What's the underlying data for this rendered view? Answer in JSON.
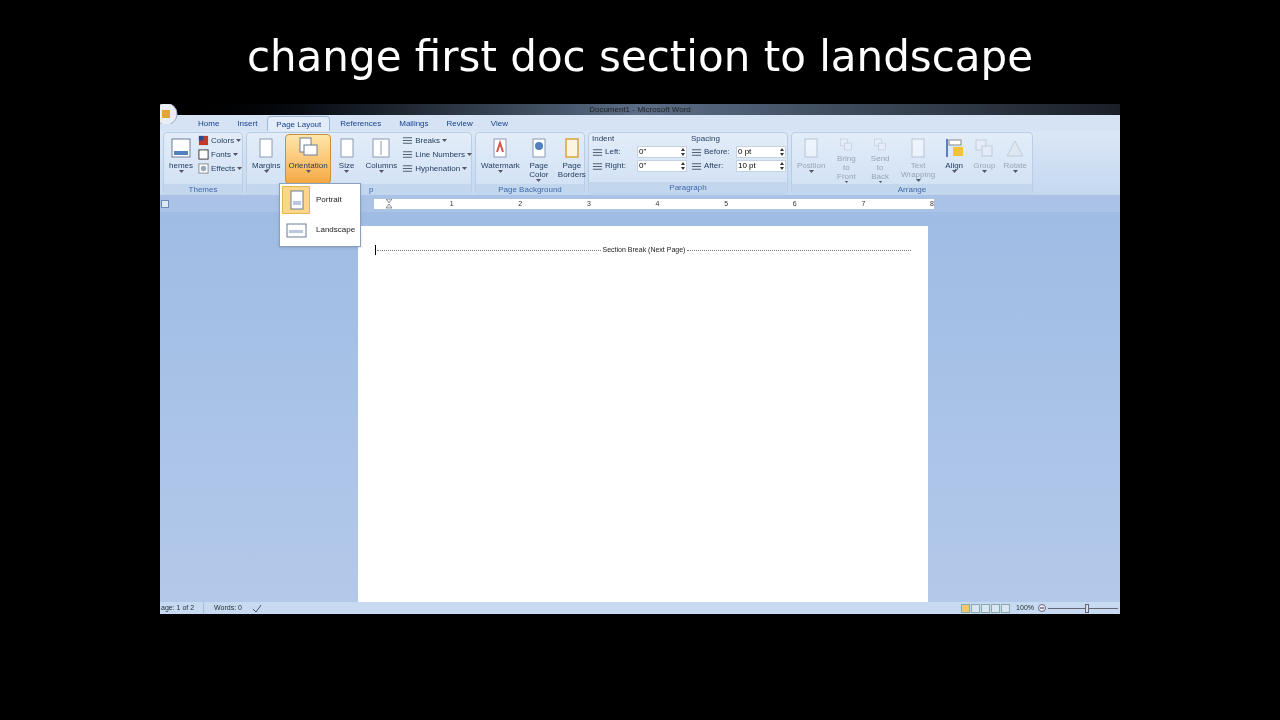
{
  "caption": "change first doc section to landscape",
  "window": {
    "title": "Document1 - Microsoft Word"
  },
  "tabs": [
    {
      "label": "Home",
      "selected": false
    },
    {
      "label": "Insert",
      "selected": false
    },
    {
      "label": "Page Layout",
      "selected": true
    },
    {
      "label": "References",
      "selected": false
    },
    {
      "label": "Mailings",
      "selected": false
    },
    {
      "label": "Review",
      "selected": false
    },
    {
      "label": "View",
      "selected": false
    }
  ],
  "groups": [
    {
      "label": "Themes",
      "items": [
        {
          "kind": "large",
          "label": "hemes",
          "dropdown": true,
          "selected": false,
          "disabled": false
        },
        {
          "kind": "stack",
          "items": [
            {
              "label": "Colors",
              "dropdown": true
            },
            {
              "label": "Fonts",
              "dropdown": true
            },
            {
              "label": "Effects",
              "dropdown": true
            }
          ]
        }
      ]
    },
    {
      "label": "p",
      "items": [
        {
          "kind": "large",
          "label": "Margins",
          "dropdown": true,
          "selected": false,
          "disabled": false
        },
        {
          "kind": "large",
          "label": "Orientation",
          "dropdown": true,
          "selected": true,
          "disabled": false
        },
        {
          "kind": "large",
          "label": "Size",
          "dropdown": true,
          "selected": false,
          "disabled": false
        },
        {
          "kind": "large",
          "label": "Columns",
          "dropdown": true,
          "selected": false,
          "disabled": false
        },
        {
          "kind": "stack",
          "items": [
            {
              "label": "Breaks",
              "dropdown": true
            },
            {
              "label": "Line Numbers",
              "dropdown": true
            },
            {
              "label": "Hyphenation",
              "dropdown": true
            }
          ]
        }
      ]
    },
    {
      "label": "Page Background",
      "items": [
        {
          "kind": "large",
          "label": "Watermark",
          "dropdown": true,
          "selected": false,
          "disabled": false
        },
        {
          "kind": "large",
          "label": "Page\nColor",
          "dropdown": true,
          "selected": false,
          "disabled": false
        },
        {
          "kind": "large",
          "label": "Page\nBorders",
          "dropdown": false,
          "selected": false,
          "disabled": false
        }
      ]
    },
    {
      "label": "Paragraph",
      "items": [
        {
          "kind": "spins",
          "heading": "Indent",
          "fields": [
            {
              "label": "Left:",
              "value": "0\""
            },
            {
              "label": "Right:",
              "value": "0\""
            }
          ]
        },
        {
          "kind": "spins",
          "heading": "Spacing",
          "fields": [
            {
              "label": "Before:",
              "value": "0 pt"
            },
            {
              "label": "After:",
              "value": "10 pt"
            }
          ]
        }
      ]
    },
    {
      "label": "Arrange",
      "items": [
        {
          "kind": "large",
          "label": "Position",
          "dropdown": true,
          "selected": false,
          "disabled": true
        },
        {
          "kind": "large",
          "label": "Bring to\nFront",
          "dropdown": true,
          "selected": false,
          "disabled": true
        },
        {
          "kind": "large",
          "label": "Send to\nBack",
          "dropdown": true,
          "selected": false,
          "disabled": true
        },
        {
          "kind": "large",
          "label": "Text\nWrapping",
          "dropdown": true,
          "selected": false,
          "disabled": true
        },
        {
          "kind": "large",
          "label": "Align",
          "dropdown": true,
          "selected": false,
          "disabled": false
        },
        {
          "kind": "large",
          "label": "Group",
          "dropdown": true,
          "selected": false,
          "disabled": true
        },
        {
          "kind": "large",
          "label": "Rotate",
          "dropdown": true,
          "selected": false,
          "disabled": true
        }
      ]
    }
  ],
  "ruler": {
    "numbers": [
      "1",
      "2",
      "3",
      "4",
      "5",
      "6",
      "7",
      "8"
    ]
  },
  "menu": [
    {
      "label": "Portrait",
      "selected": true
    },
    {
      "label": "Landscape",
      "selected": false
    }
  ],
  "document": {
    "section_break": "Section Break (Next Page)"
  },
  "status_bar": {
    "page": "age: 1 of 2",
    "words": "Words: 0",
    "zoom": "100%",
    "zoom_slider": {
      "level": 0.55
    }
  }
}
